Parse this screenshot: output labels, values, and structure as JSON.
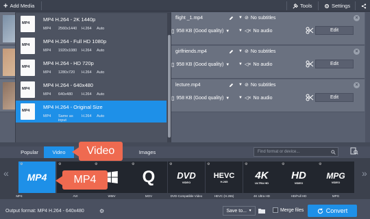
{
  "topbar": {
    "add_media": "Add Media",
    "tools": "Tools",
    "settings": "Settings"
  },
  "files": [
    {
      "name": "flight _1.mp4",
      "subtitles": "No subtitles",
      "size": "958 KB (Good quality)",
      "audio": "No audio",
      "edit": "Edit"
    },
    {
      "name": "girlfriends.mp4",
      "subtitles": "No subtitles",
      "size": "958 KB (Good quality)",
      "audio": "No audio",
      "edit": "Edit"
    },
    {
      "name": "lecture.mp4",
      "subtitles": "No subtitles",
      "size": "958 KB (Good quality)",
      "audio": "No audio",
      "edit": "Edit"
    }
  ],
  "dropdown": {
    "items": [
      {
        "title": "MP4 H.264 - 2K 1440p",
        "spec": [
          "MP4",
          "2560x1440",
          "H.264",
          "Auto"
        ]
      },
      {
        "title": "MP4 H.264 - Full HD 1080p",
        "spec": [
          "MP4",
          "1920x1080",
          "H.264",
          "Auto"
        ]
      },
      {
        "title": "MP4 H.264 - HD 720p",
        "spec": [
          "MP4",
          "1280x720",
          "H.264",
          "Auto"
        ]
      },
      {
        "title": "MP4 H.264 - 640x480",
        "spec": [
          "MP4",
          "640x480",
          "H.264",
          "Auto"
        ]
      },
      {
        "title": "MP4 H.264 - Original Size",
        "spec": [
          "MP4",
          "Same as input",
          "H.264",
          "Auto"
        ]
      }
    ],
    "selected_index": 4
  },
  "tabs": {
    "popular": "Popular",
    "video": "Video",
    "images": "Images"
  },
  "search": {
    "placeholder": "Find format or device..."
  },
  "formats": [
    {
      "label": "MP4",
      "logo": "MP4"
    },
    {
      "label": "AVI",
      "logo": ""
    },
    {
      "label": "WMV",
      "logo": ""
    },
    {
      "label": "MOV",
      "logo": "Q"
    },
    {
      "label": "DVD-Compatible Video",
      "logo": "DVD",
      "sub": "VIDEO"
    },
    {
      "label": "HEVC (H.265)",
      "logo": "HEVC",
      "sub": "H.265"
    },
    {
      "label": "4K Ultra HD",
      "logo": "4K",
      "sub": "ULTRA HD"
    },
    {
      "label": "HD/Full HD",
      "logo": "HD",
      "sub": "VIDEO"
    },
    {
      "label": "MPG",
      "logo": "MPG",
      "sub": "VIDEO"
    }
  ],
  "callouts": {
    "video": "Video",
    "mp4": "MP4"
  },
  "bottom": {
    "output_format": "Output format: MP4 H.264 - 640x480",
    "save_to": "Save to...",
    "merge": "Merge files",
    "convert": "Convert"
  },
  "colors": {
    "accent": "#1e90e8",
    "callout": "#ef6a50"
  }
}
